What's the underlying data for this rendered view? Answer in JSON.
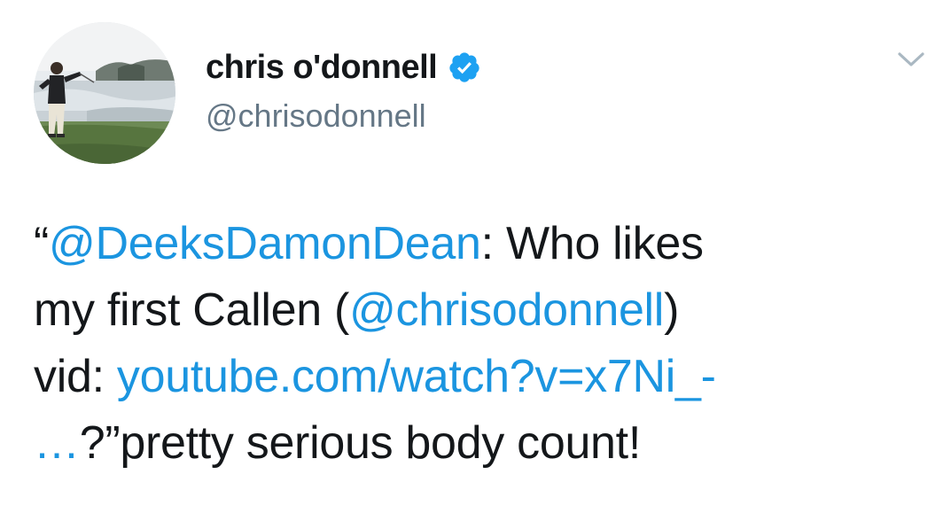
{
  "tweet": {
    "author": {
      "display_name": "chris o'donnell",
      "handle": "@chrisodonnell",
      "verified": true,
      "avatar": "golfer-on-coast-photo"
    },
    "menu_icon": "chevron-down-icon",
    "text": {
      "open_quote": "“",
      "mention_1": "@DeeksDamonDean",
      "part_1": ": Who likes",
      "part_2": "my first Callen (",
      "mention_2": "@chrisodonnell",
      "part_3": ")",
      "part_4": "vid: ",
      "url_part_1": "youtube.com/watch?v=x7Ni_-",
      "url_part_2": "…",
      "part_5": "?”pretty serious body count!"
    }
  },
  "colors": {
    "link": "#1b95e0",
    "verified": "#1da1f2",
    "text": "#14171a",
    "secondary": "#657786",
    "caret": "#aab8c2"
  }
}
